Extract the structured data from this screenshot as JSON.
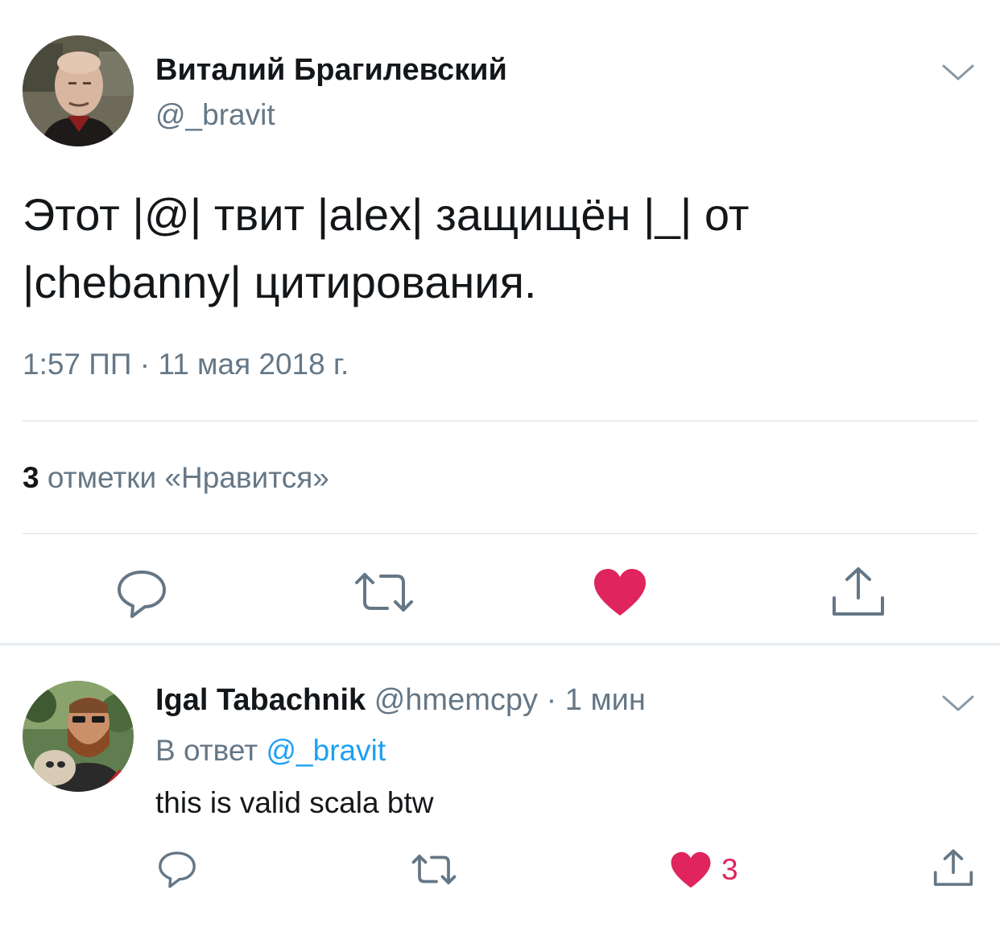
{
  "colors": {
    "accent": "#1da1f2",
    "like": "#e0245e",
    "muted": "#657786",
    "divider": "#e6ecf0"
  },
  "main_tweet": {
    "author_name": "Виталий Брагилевский",
    "author_handle": "@_bravit",
    "text_line1": "Этот |@| твит |alex| защищён |_| от",
    "text_line2": "|chebanny| цитирования.",
    "timestamp": "1:57 ПП · 11 мая 2018 г.",
    "likes_count": "3",
    "likes_label": "отметки «Нравится»",
    "liked": true
  },
  "reply": {
    "author_name": "Igal Tabachnik",
    "author_handle": "@hmemcpy",
    "time": "· 1 мин",
    "reply_prefix": "В ответ",
    "reply_mention": "@_bravit",
    "text": "this is valid scala btw",
    "likes_count": "3",
    "liked": true
  },
  "icons": [
    "chevron-down-icon",
    "reply-icon",
    "retweet-icon",
    "heart-icon",
    "share-icon"
  ]
}
